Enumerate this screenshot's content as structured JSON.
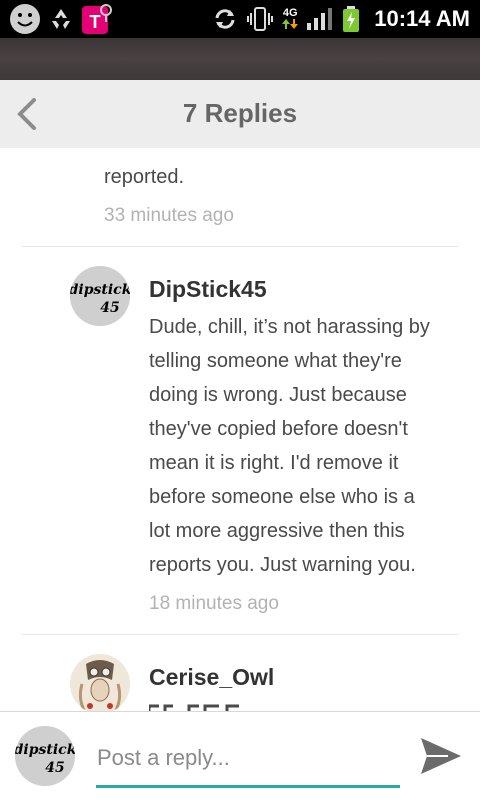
{
  "status_bar": {
    "time": "10:14 AM",
    "network": "4G"
  },
  "header": {
    "title": "7 Replies"
  },
  "replies": [
    {
      "text_visible": [
        "reported."
      ],
      "time": "33 minutes ago"
    },
    {
      "username": "DipStick45",
      "avatar_text": "dipstick 45",
      "lines": [
        "Dude, chill, it’s not harassing by",
        "telling someone what they're",
        "doing is wrong. Just because",
        "they've copied before doesn't",
        "mean it is right. I'd remove it",
        "before someone else who is a",
        "lot more aggressive then this",
        "reports you. Just warning you."
      ],
      "time": "18 minutes ago"
    },
    {
      "username": "Cerise_Owl"
    }
  ],
  "reply_bar": {
    "placeholder": "Post a reply...",
    "avatar_text": "dipstick 45"
  },
  "colors": {
    "accent": "#2aa7a0",
    "header_bg": "#ededed",
    "status_bar": "#000000"
  }
}
